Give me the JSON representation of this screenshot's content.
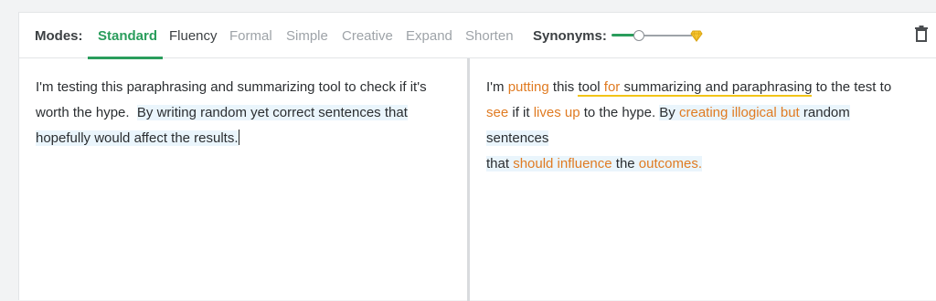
{
  "toolbar": {
    "modes_label": "Modes:",
    "modes": [
      "Standard",
      "Fluency",
      "Formal",
      "Simple",
      "Creative",
      "Expand",
      "Shorten"
    ],
    "active_mode": "Standard",
    "synonyms_label": "Synonyms:",
    "synonyms_level": 0.3
  },
  "input": {
    "line1": "I'm testing this paraphrasing and summarizing tool to check if it's",
    "line2a": "worth the hype.",
    "line2b": "By writing random yet correct sentences that",
    "line3": "hopefully would affect the results."
  },
  "output": {
    "t1": "I'm ",
    "c1": "putting",
    "t2": " this ",
    "u1": "tool ",
    "c2": "for",
    "u2": " summarizing and paraphrasing",
    "t3": " to the test to",
    "c3": "see",
    "t4": " if it ",
    "c4": "lives up",
    "t5": " to the hype. ",
    "t6": "By ",
    "c5": "creating illogical but",
    "t7": " random sentences",
    "t8": "that ",
    "c6": "should influence",
    "t9": " the ",
    "c7": "outcomes."
  },
  "colors": {
    "accent": "#2a9d5c",
    "changed": "#e07b22",
    "highlight": "#eaf5fc",
    "underline": "#f2c417"
  }
}
